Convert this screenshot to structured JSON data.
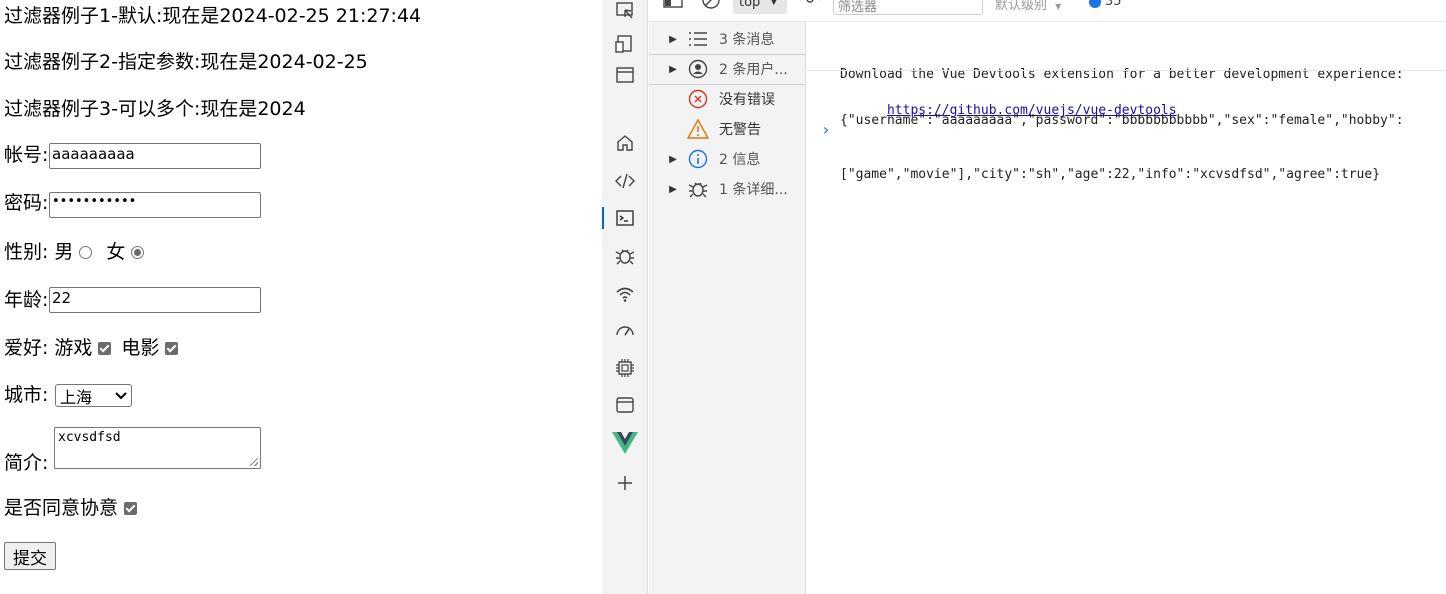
{
  "page": {
    "filter1": "过滤器例子1-默认:现在是2024-02-25 21:27:44",
    "filter2": "过滤器例子2-指定参数:现在是2024-02-25",
    "filter3": "过滤器例子3-可以多个:现在是2024",
    "username_label": "帐号:",
    "username_value": "aaaaaaaaa",
    "password_label": "密码:",
    "password_mask": "•••••••••••",
    "gender_label": "性别:",
    "gender_male": "男",
    "gender_female": "女",
    "gender_selected": "female",
    "age_label": "年龄:",
    "age_value": "22",
    "hobby_label": "爱好:",
    "hobby_game": "游戏",
    "hobby_movie": "电影",
    "city_label": "城市:",
    "city_value": "上海",
    "intro_label": "简介:",
    "intro_value": "xcvsdfsd",
    "agree_label": "是否同意协意",
    "submit_label": "提交"
  },
  "devtools": {
    "context": "top",
    "filter_placeholder": "筛选器",
    "level": "默认级别",
    "issues_count": "35",
    "sidebar": [
      {
        "label": "3 条消息",
        "icon": "list-icon"
      },
      {
        "label": "2 条用户...",
        "icon": "user-icon"
      },
      {
        "label": "没有错误",
        "icon": "error-icon"
      },
      {
        "label": "无警告",
        "icon": "warning-icon"
      },
      {
        "label": "2 信息",
        "icon": "info-icon"
      },
      {
        "label": "1 条详细...",
        "icon": "bug-icon"
      }
    ],
    "console": {
      "msg1": "Download the Vue Devtools extension for a better development experience:",
      "msg1_link": "https://github.com/vuejs/vue-devtools",
      "msg2_line1": "{\"username\":\"aaaaaaaaa\",\"password\":\"bbbbbbbbbbb\",\"sex\":\"female\",\"hobby\":",
      "msg2_line2": "[\"game\",\"movie\"],\"city\":\"sh\",\"age\":22,\"info\":\"xcvsdfsd\",\"agree\":true}"
    }
  }
}
